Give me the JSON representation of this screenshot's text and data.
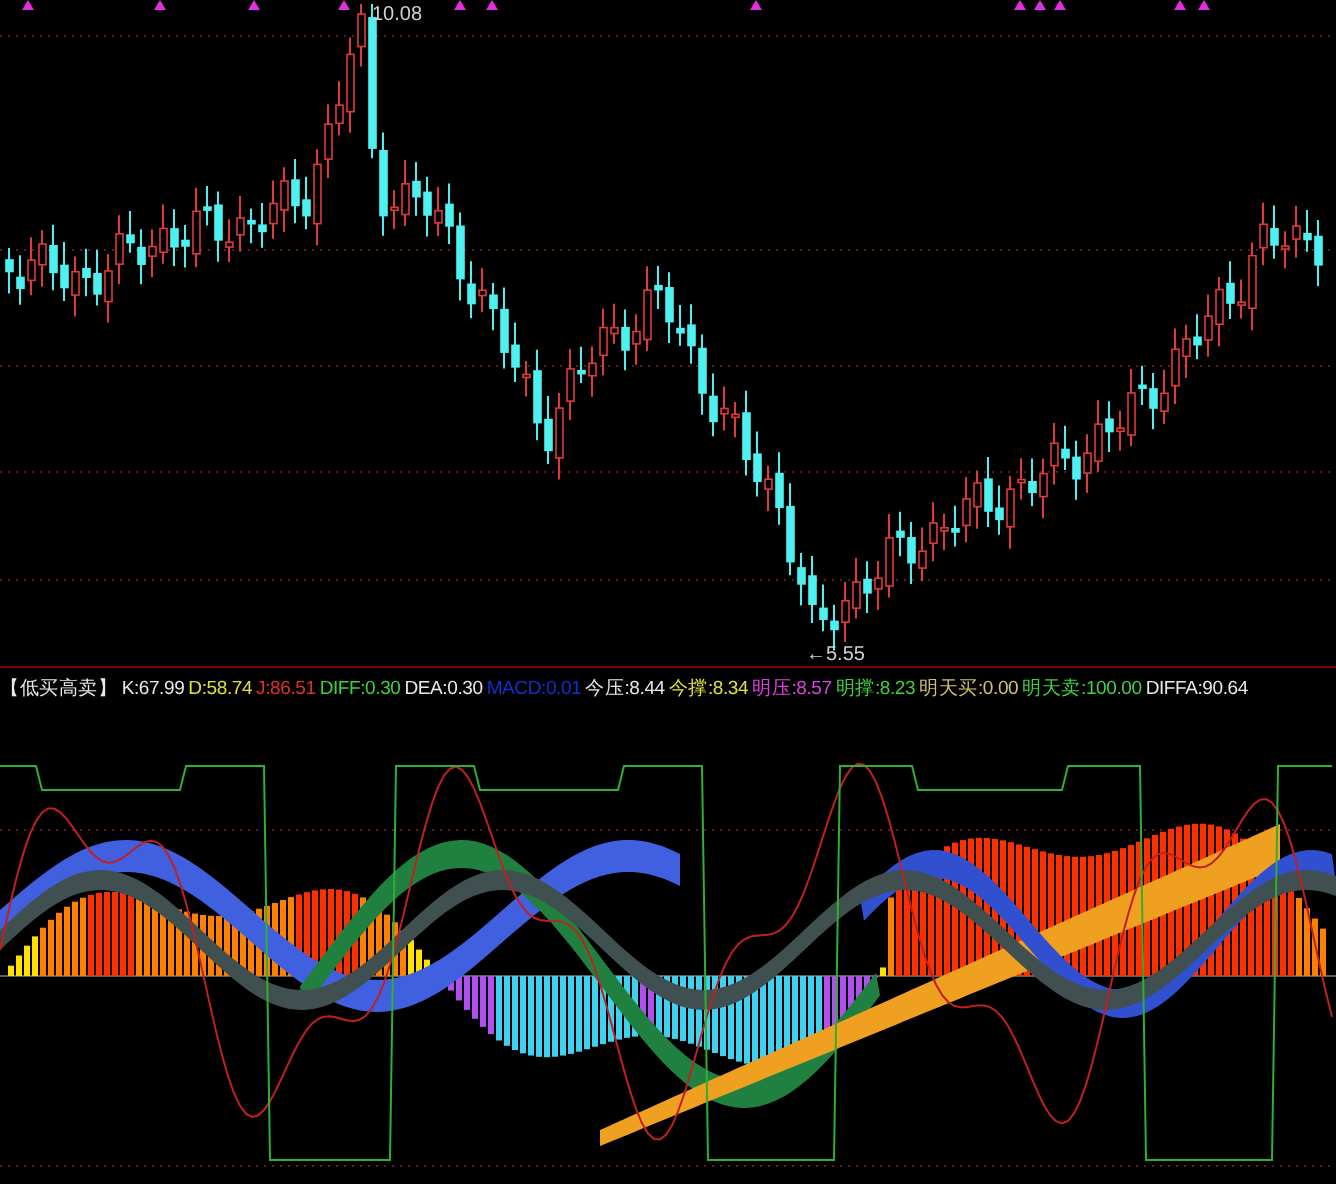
{
  "price_chart": {
    "high_label": "10.08",
    "low_label": "←5.55"
  },
  "indicator": {
    "title": "【低买高卖】",
    "values": [
      {
        "label": "K:67.99",
        "color": "#e8e8e8"
      },
      {
        "label": "D:58.74",
        "color": "#e0e040"
      },
      {
        "label": "J:86.51",
        "color": "#e03030"
      },
      {
        "label": "DIFF:0.30",
        "color": "#40d040"
      },
      {
        "label": "DEA:0.30",
        "color": "#e8e8e8"
      },
      {
        "label": "MACD:0.01",
        "color": "#1030d0"
      },
      {
        "label": "今压:8.44",
        "color": "#e8e8e8"
      },
      {
        "label": "今撑:8.34",
        "color": "#e0e040"
      },
      {
        "label": "明压:8.57",
        "color": "#e040e0"
      },
      {
        "label": "明撑:8.23",
        "color": "#40d040"
      },
      {
        "label": "明天买:0.00",
        "color": "#d0c070"
      },
      {
        "label": "明天卖:100.00",
        "color": "#40d040"
      },
      {
        "label": "DIFFA:90.64",
        "color": "#e8e8e8"
      }
    ]
  }
}
